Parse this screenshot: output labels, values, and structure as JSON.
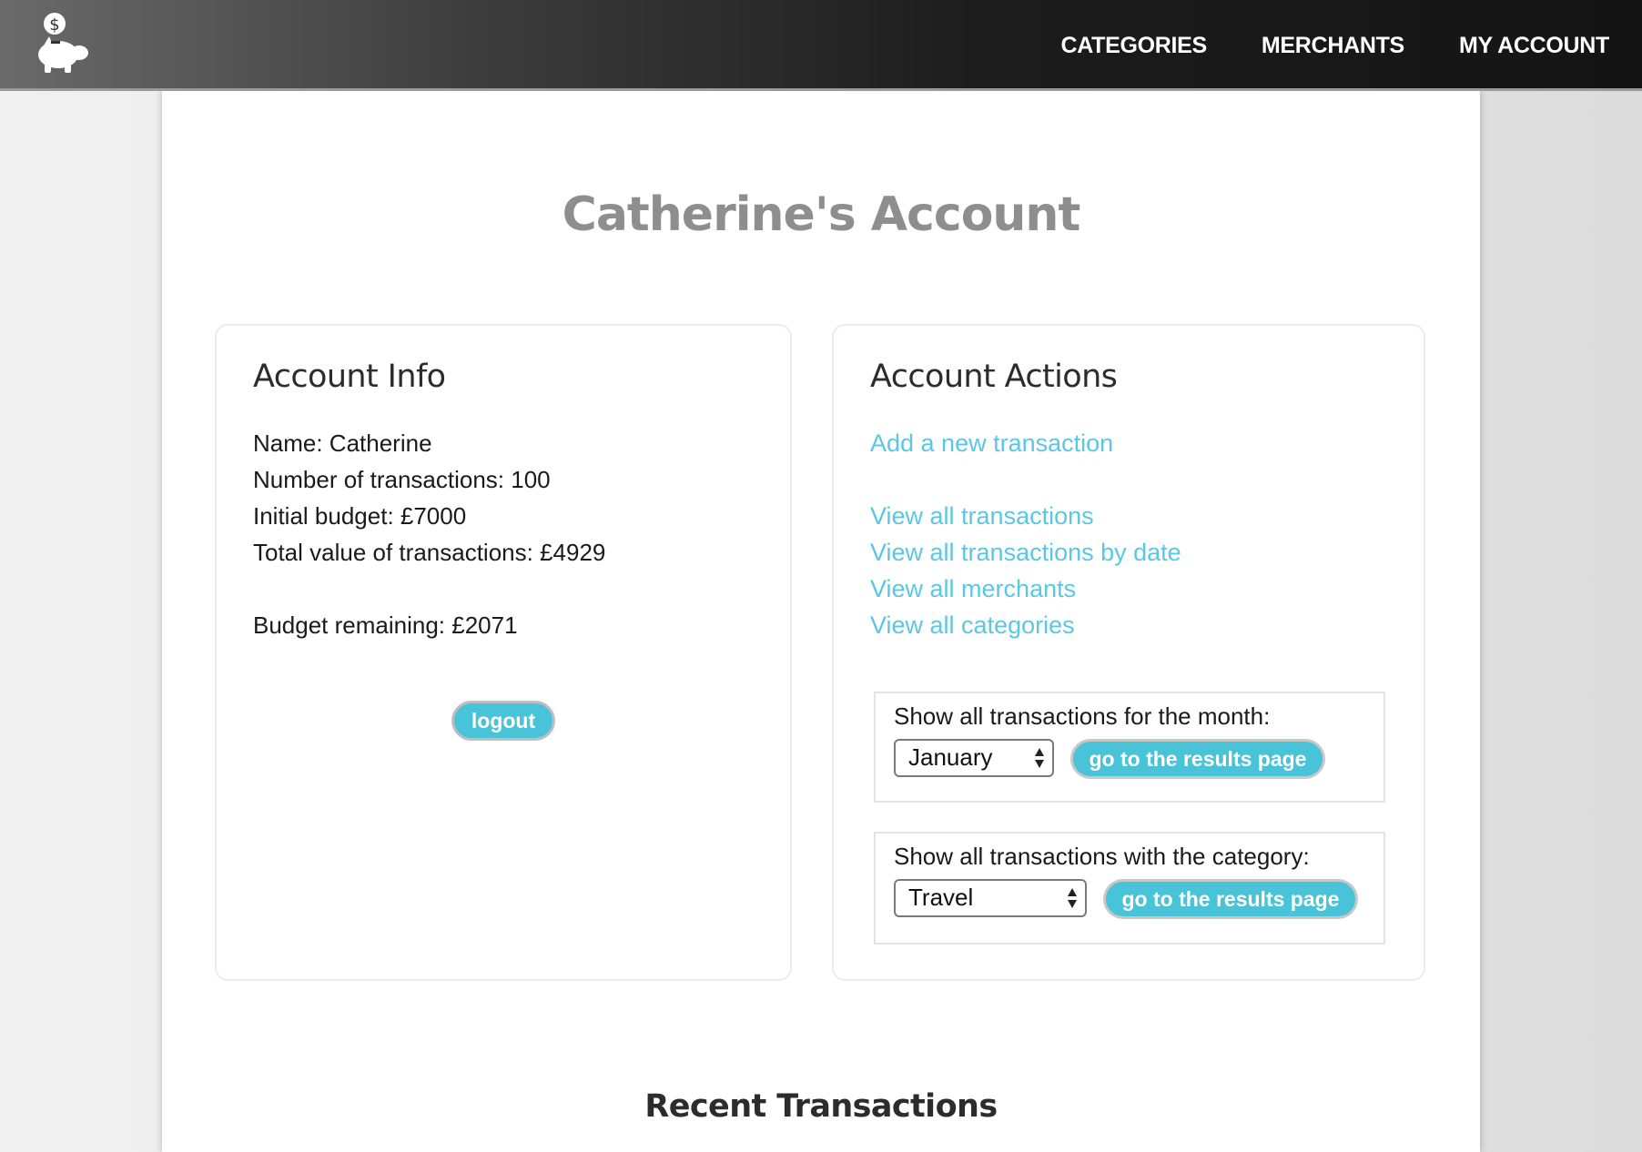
{
  "nav": {
    "links": [
      "CATEGORIES",
      "MERCHANTS",
      "MY ACCOUNT"
    ],
    "logo_icon": "piggy-bank-dollar-icon"
  },
  "page": {
    "title": "Catherine's Account"
  },
  "account_info": {
    "title": "Account Info",
    "name": "Name: Catherine",
    "transactions": "Number of transactions: 100",
    "initial_budget": "Initial budget: £7000",
    "total_value": "Total value of transactions: £4929",
    "budget_remaining": "Budget remaining: £2071",
    "logout_label": "logout"
  },
  "account_actions": {
    "title": "Account Actions",
    "add_transaction": "Add a new transaction",
    "view_all_transactions": "View all transactions",
    "view_by_date": "View all transactions by date",
    "view_merchants": "View all merchants",
    "view_categories": "View all categories",
    "month_filter": {
      "label": "Show all transactions for the month:",
      "selected": "January",
      "button": "go to the results page"
    },
    "category_filter": {
      "label": "Show all transactions with the category:",
      "selected": "Travel",
      "button": "go to the results page"
    }
  },
  "recent": {
    "title": "Recent Transactions"
  },
  "colors": {
    "accent": "#48c3d8",
    "link": "#5bc7e4",
    "title_grey": "#8e8e8e"
  }
}
